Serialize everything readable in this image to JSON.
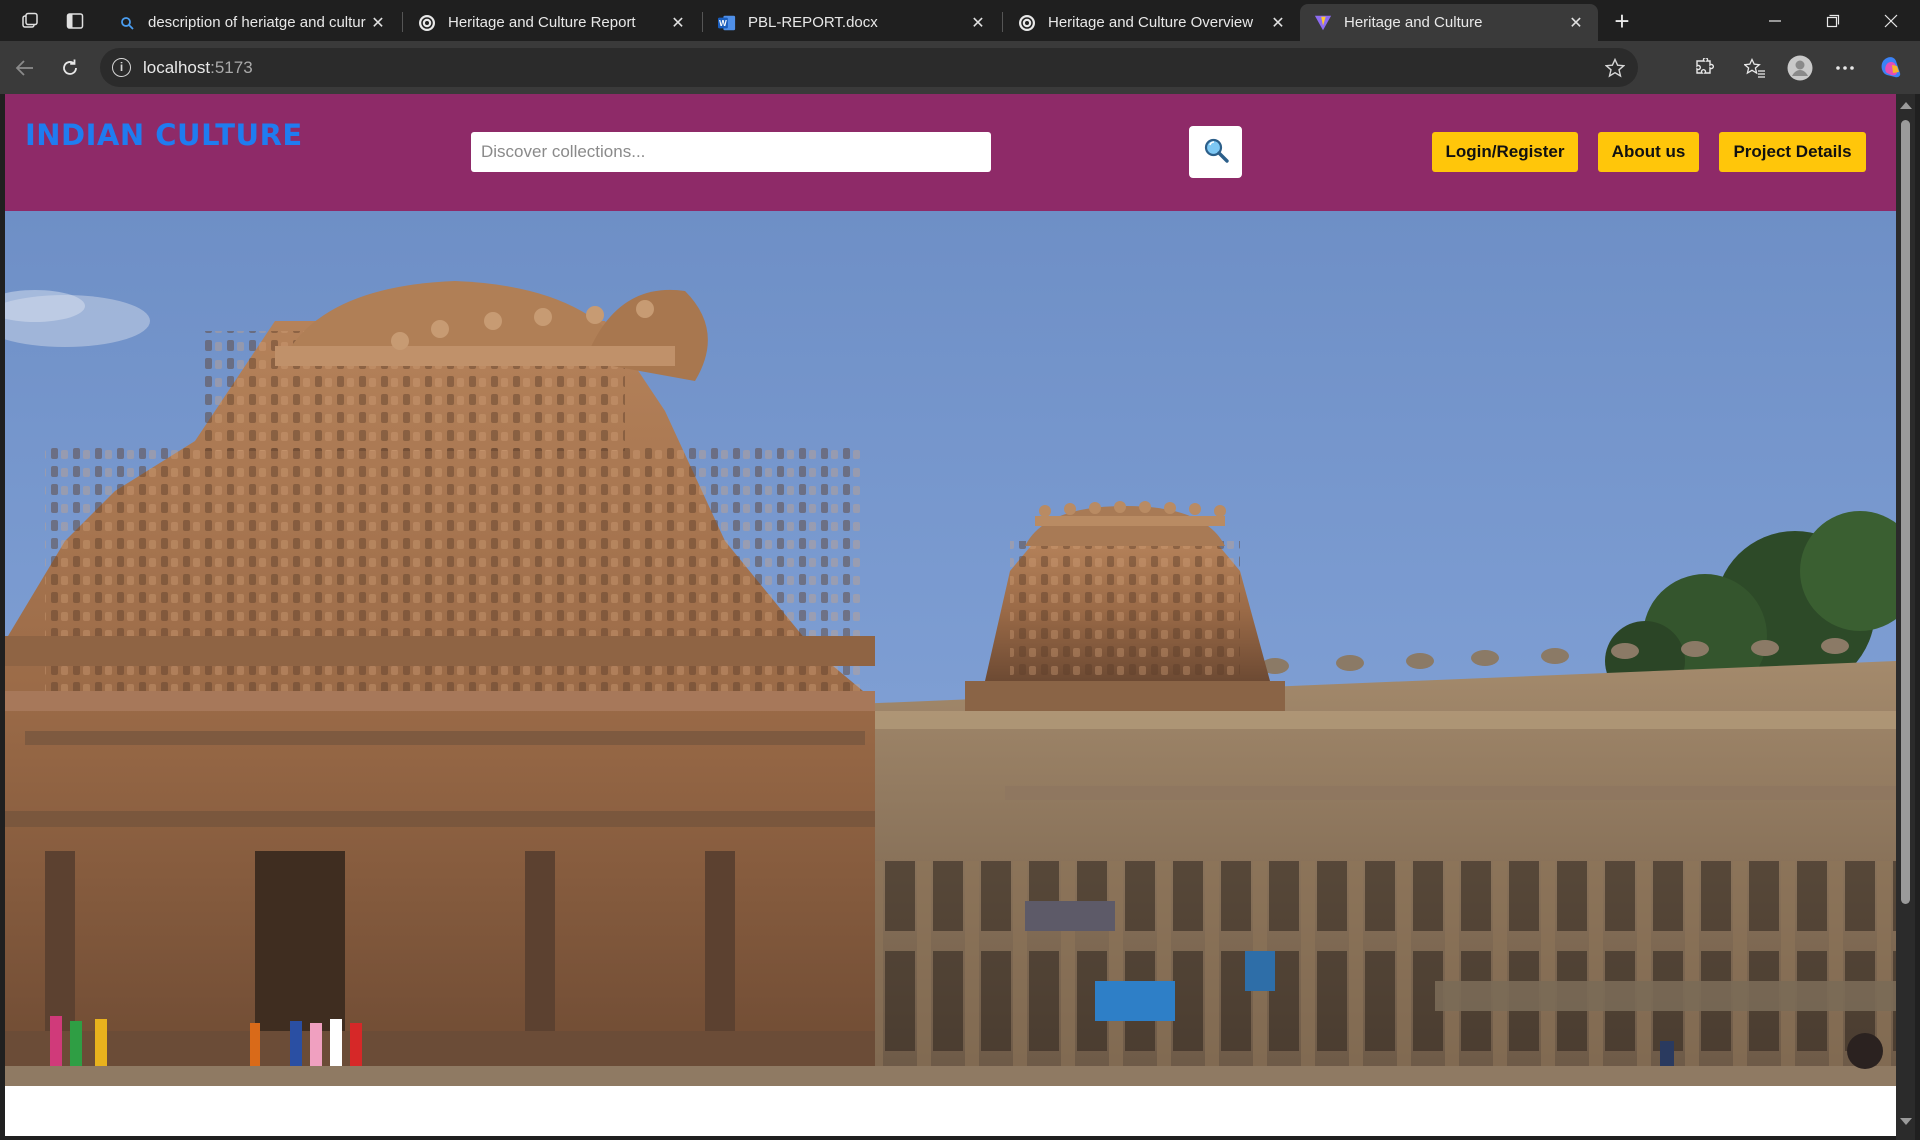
{
  "browser": {
    "tabs": [
      {
        "title": "description of heriatge and cultur",
        "icon": "search-icon"
      },
      {
        "title": "Heritage and Culture Report",
        "icon": "chatgpt-icon"
      },
      {
        "title": "PBL-REPORT.docx",
        "icon": "word-icon"
      },
      {
        "title": "Heritage and Culture Overview",
        "icon": "chatgpt-icon"
      },
      {
        "title": "Heritage and Culture",
        "icon": "vite-icon"
      }
    ],
    "active_tab_index": 4,
    "address": {
      "host": "localhost",
      "port": ":5173"
    }
  },
  "header": {
    "logo": "INDIAN CULTURE",
    "search_placeholder": "Discover collections...",
    "buttons": {
      "login": "Login/Register",
      "about": "About us",
      "project": "Project Details"
    }
  },
  "colors": {
    "header_bg": "#8e2a68",
    "logo": "#1f7cf0",
    "button_bg": "#ffc60a"
  },
  "hero": {
    "subject": "temple-photo"
  }
}
